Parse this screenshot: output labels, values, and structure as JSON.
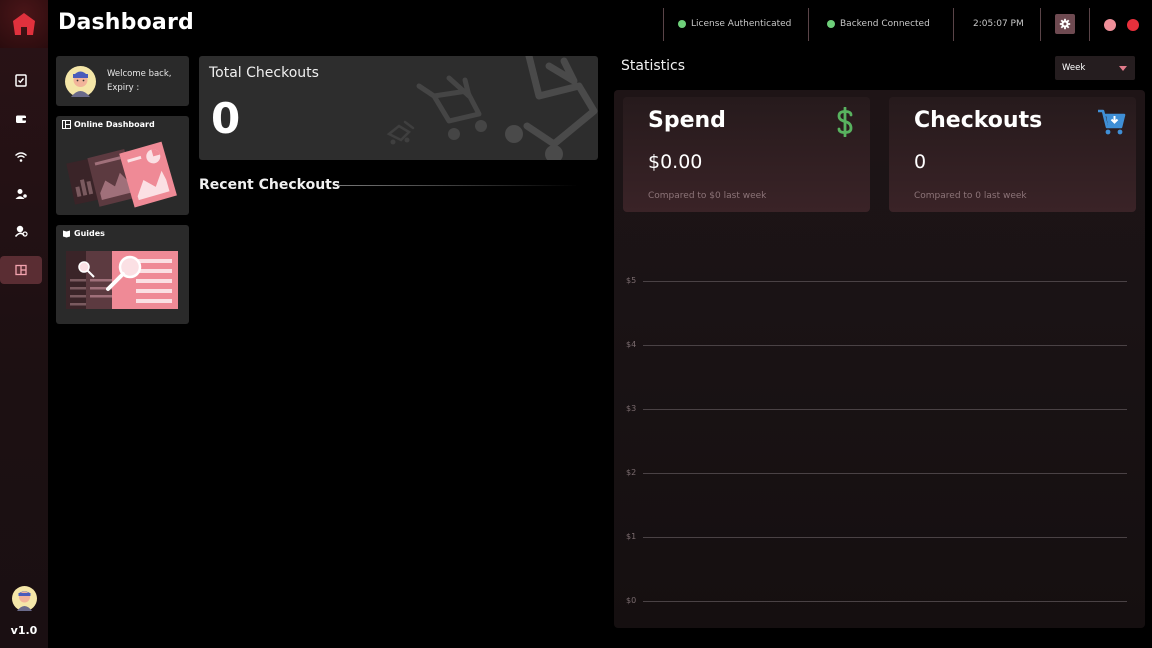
{
  "header": {
    "title": "Dashboard",
    "license_status": "License Authenticated",
    "backend_status": "Backend Connected",
    "time": "2:05:07 PM",
    "status_color": "#6ed07a"
  },
  "sidebar": {
    "items": [
      {
        "name": "tasks",
        "icon": "clipboard-check-icon"
      },
      {
        "name": "wallet",
        "icon": "wallet-icon"
      },
      {
        "name": "proxies",
        "icon": "wifi-icon"
      },
      {
        "name": "profiles",
        "icon": "users-icon"
      },
      {
        "name": "accounts",
        "icon": "user-settings-icon"
      },
      {
        "name": "dashboard",
        "icon": "dashboard-icon",
        "active": true
      }
    ],
    "version": "v1.0"
  },
  "welcome": {
    "line1": "Welcome back,",
    "line2": "Expiry :"
  },
  "online_dashboard": {
    "label": "Online Dashboard"
  },
  "guides": {
    "label": "Guides"
  },
  "total_checkouts": {
    "title": "Total Checkouts",
    "count": "0"
  },
  "recent_checkouts": {
    "title": "Recent Checkouts"
  },
  "statistics": {
    "title": "Statistics",
    "period": "Week",
    "spend": {
      "label": "Spend",
      "value": "$0.00",
      "compare": "Compared to $0 last week"
    },
    "checkouts": {
      "label": "Checkouts",
      "value": "0",
      "compare": "Compared to 0 last week"
    },
    "y_ticks": [
      "$5",
      "$4",
      "$3",
      "$2",
      "$1",
      "$0"
    ]
  },
  "colors": {
    "accent": "#e07a8a",
    "dollar_icon": "#58b25f",
    "cart_icon": "#3f8fd6"
  }
}
